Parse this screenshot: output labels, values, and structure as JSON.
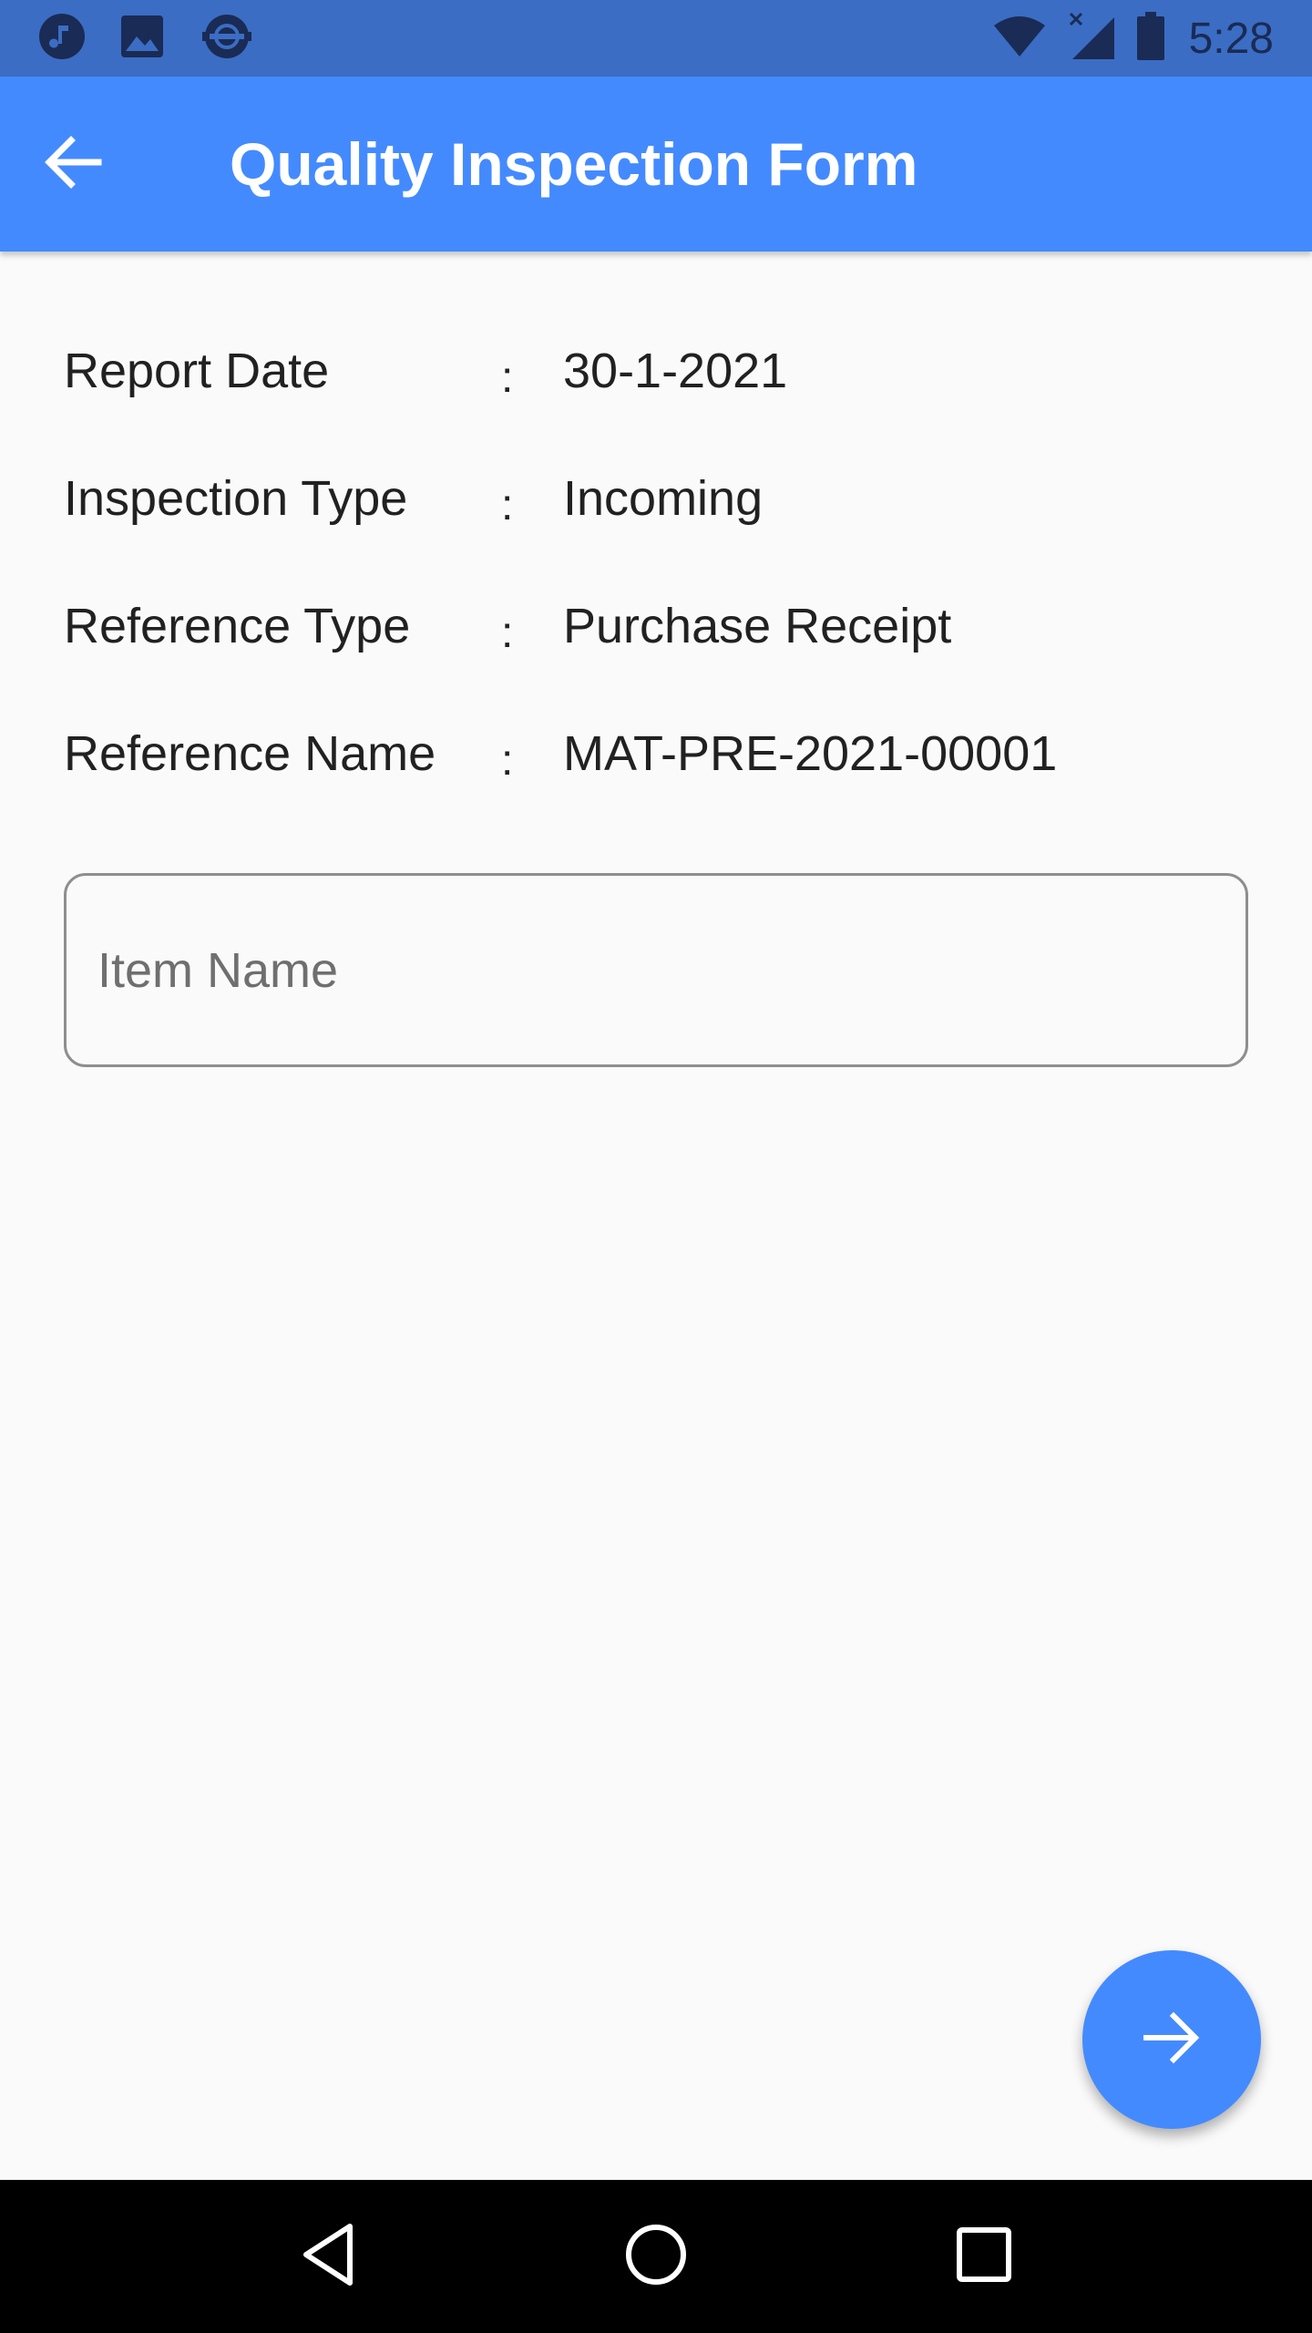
{
  "status_bar": {
    "time": "5:28",
    "left_icons": [
      "music-notification-icon",
      "image-notification-icon",
      "sync-notification-icon"
    ],
    "right_icons": [
      "wifi-icon",
      "cell-signal-icon",
      "battery-icon"
    ],
    "color": "#3b6dc4"
  },
  "app_bar": {
    "title": "Quality Inspection Form",
    "back_icon": "arrow-back-icon",
    "color": "#448aff"
  },
  "details": {
    "separator": ":",
    "rows": [
      {
        "label": "Report Date",
        "value": "30-1-2021"
      },
      {
        "label": "Inspection Type",
        "value": "Incoming"
      },
      {
        "label": "Reference Type",
        "value": "Purchase Receipt"
      },
      {
        "label": "Reference Name",
        "value": "MAT-PRE-2021-00001"
      }
    ]
  },
  "item_field": {
    "placeholder": "Item Name",
    "value": ""
  },
  "fab": {
    "icon": "arrow-forward-icon",
    "color": "#448aff"
  },
  "nav_bar": {
    "buttons": [
      "back-triangle-icon",
      "home-circle-icon",
      "recents-square-icon"
    ]
  }
}
